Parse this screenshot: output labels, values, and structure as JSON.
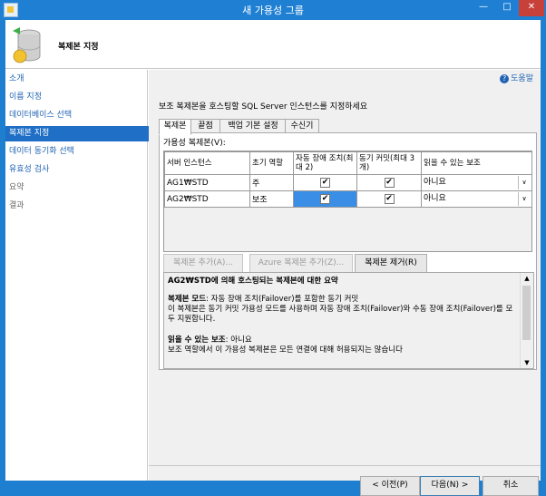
{
  "window": {
    "title": "새 가용성 그룹",
    "minimize": "—",
    "maximize": "□",
    "close": "✕"
  },
  "header": {
    "title": "복제본 지정"
  },
  "sidebar": {
    "items": [
      {
        "label": "소개"
      },
      {
        "label": "이름 지정"
      },
      {
        "label": "데이터베이스 선택"
      },
      {
        "label": "복제본 지정"
      },
      {
        "label": "데이터 동기화 선택"
      },
      {
        "label": "유효성 검사"
      },
      {
        "label": "요약"
      },
      {
        "label": "결과"
      }
    ]
  },
  "main": {
    "help": "도움말",
    "help_glyph": "?",
    "instruction": "보조 복제본을 호스팅할 SQL Server 인스턴스를 지정하세요",
    "tabs": [
      {
        "label": "복제본"
      },
      {
        "label": "끝점"
      },
      {
        "label": "백업 기본 설정"
      },
      {
        "label": "수신기"
      }
    ],
    "replicas_label": "가용성 복제본(V):",
    "columns": [
      "서버 인스턴스",
      "초기 역할",
      "자동 장애 조치(최대 2)",
      "동기 커밋(최대 3개)",
      "읽을 수 있는 보조"
    ],
    "rows": [
      {
        "server": "AG1₩STD",
        "role": "주",
        "auto_failover": true,
        "sync_commit": true,
        "readable": "아니요"
      },
      {
        "server": "AG2₩STD",
        "role": "보조",
        "auto_failover": true,
        "sync_commit": true,
        "readable": "아니요"
      }
    ],
    "check_glyph": "✔",
    "dropdown_glyph": "∨",
    "buttons": {
      "add_replica": "복제본 추가(A)...",
      "add_azure_replica": "Azure 복제본 추가(Z)...",
      "remove_replica": "복제본 제거(R)"
    },
    "summary": {
      "heading": "AG2₩STD에 의해 호스팅되는 복제본에 대한 요약",
      "mode_label": "복제본 모드",
      "mode_text": ": 자동 장애 조치(Failover)를 포함한 동기 커밋",
      "mode_desc": "이 복제본은 동기 커밋 가용성 모드를 사용하며 자동 장애 조치(Failover)와 수동 장애 조치(Failover)를 모두 지원합니다.",
      "readable_label": "읽을 수 있는 보조",
      "readable_text": ": 아니요",
      "readable_desc": "보조 역할에서 이 가용성 복제본은 모든 연결에 대해 허용되지는 않습니다"
    }
  },
  "footer": {
    "prev": "< 이전(P)",
    "next": "다음(N) >",
    "cancel": "취소"
  },
  "colors": {
    "titlebar": "#1f80d3",
    "selected": "#1f6fc6",
    "link": "#1f63b4",
    "cell_highlight": "#3a8ee6"
  }
}
